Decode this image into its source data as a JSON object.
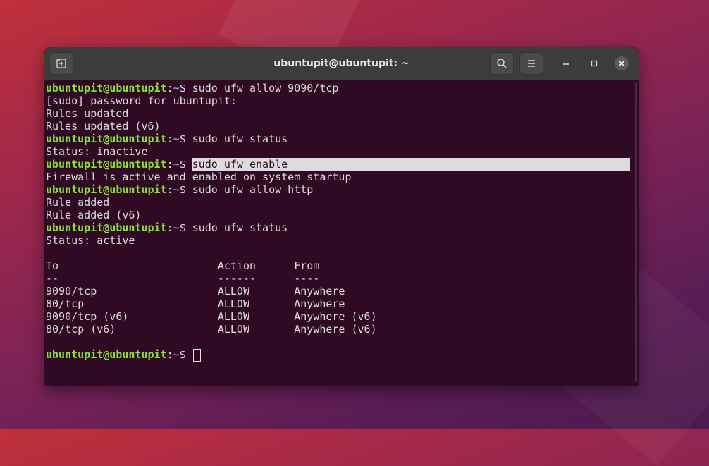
{
  "window": {
    "title": "ubuntupit@ubuntupit: ~"
  },
  "colors": {
    "terminal_bg": "#300a24",
    "prompt_user": "#8ae234",
    "prompt_path": "#729fcf",
    "text": "#dcdcdc",
    "header_bg": "#3c3c3c"
  },
  "icons": {
    "new_tab": "new-tab-icon",
    "search": "search-icon",
    "menu": "hamburger-menu-icon",
    "minimize": "minimize-icon",
    "maximize": "maximize-icon",
    "close": "close-icon"
  },
  "prompt": {
    "user": "ubuntupit@ubuntupit",
    "colon": ":",
    "path": "~",
    "symbol": "$ "
  },
  "lines": [
    {
      "type": "cmd",
      "text": "sudo ufw allow 9090/tcp"
    },
    {
      "type": "out",
      "text": "[sudo] password for ubuntupit:"
    },
    {
      "type": "out",
      "text": "Rules updated"
    },
    {
      "type": "out",
      "text": "Rules updated (v6)"
    },
    {
      "type": "cmd",
      "text": "sudo ufw status"
    },
    {
      "type": "out",
      "text": "Status: inactive"
    },
    {
      "type": "cmd",
      "text": "sudo ufw enable",
      "highlight": true
    },
    {
      "type": "out",
      "text": "Firewall is active and enabled on system startup"
    },
    {
      "type": "cmd",
      "text": "sudo ufw allow http"
    },
    {
      "type": "out",
      "text": "Rule added"
    },
    {
      "type": "out",
      "text": "Rule added (v6)"
    },
    {
      "type": "cmd",
      "text": "sudo ufw status"
    },
    {
      "type": "out",
      "text": "Status: active"
    },
    {
      "type": "out",
      "text": ""
    },
    {
      "type": "out",
      "text": "To                         Action      From"
    },
    {
      "type": "out",
      "text": "--                         ------      ----"
    },
    {
      "type": "out",
      "text": "9090/tcp                   ALLOW       Anywhere"
    },
    {
      "type": "out",
      "text": "80/tcp                     ALLOW       Anywhere"
    },
    {
      "type": "out",
      "text": "9090/tcp (v6)              ALLOW       Anywhere (v6)"
    },
    {
      "type": "out",
      "text": "80/tcp (v6)                ALLOW       Anywhere (v6)"
    },
    {
      "type": "out",
      "text": ""
    },
    {
      "type": "cursor",
      "text": ""
    }
  ]
}
